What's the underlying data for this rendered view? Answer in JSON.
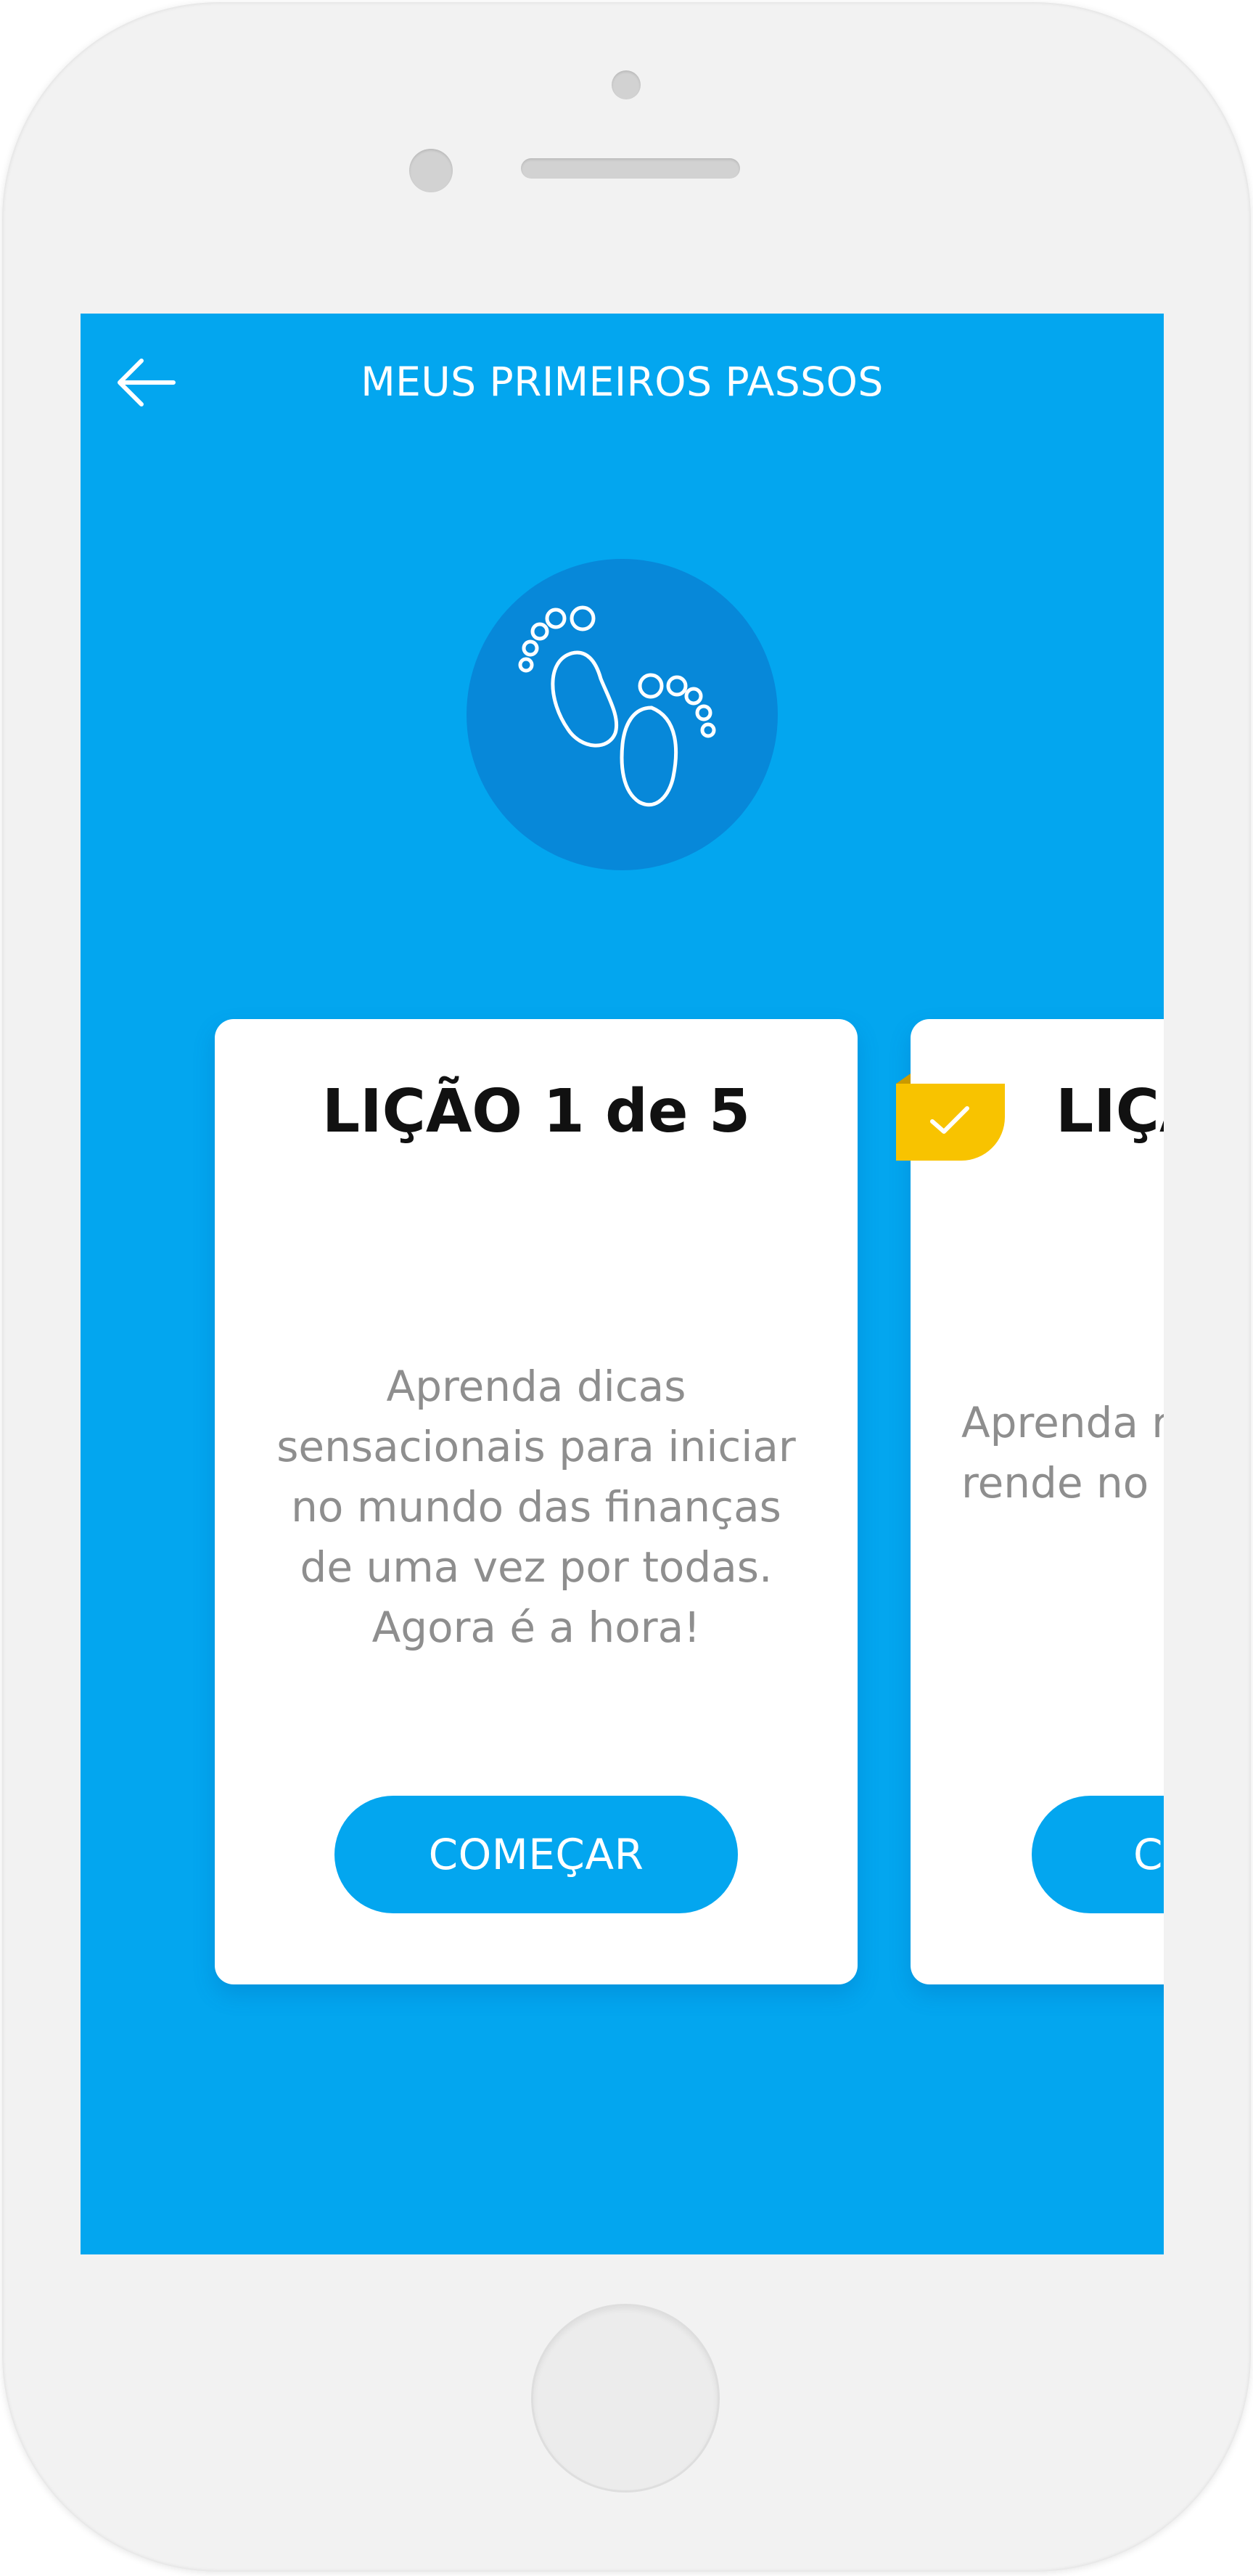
{
  "header": {
    "title": "MEUS PRIMEIROS PASSOS"
  },
  "hero": {
    "icon": "baby-footprints-icon"
  },
  "lessons": [
    {
      "title": "LIÇÃO 1 de 5",
      "description": "Aprenda dicas sensacionais para iniciar no mundo das finanças de uma vez por todas. Agora é a hora!",
      "button_label": "COMEÇAR"
    },
    {
      "title": "LIÇÃ",
      "description": "Aprenda r fixa o inves rende no m",
      "button_label": "CO",
      "completed": true
    }
  ],
  "colors": {
    "screen_background": "#03a6ef",
    "hero_circle": "#0788d9",
    "check_tag": "#f8c300"
  }
}
